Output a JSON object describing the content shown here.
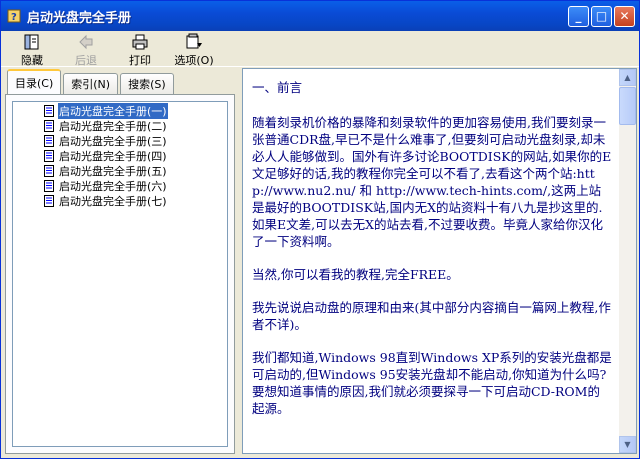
{
  "window": {
    "title": "启动光盘完全手册"
  },
  "toolbar": {
    "hide": "隐藏",
    "back": "后退",
    "print": "打印",
    "options": "选项(O)"
  },
  "tabs": [
    {
      "label": "目录(C)"
    },
    {
      "label": "索引(N)"
    },
    {
      "label": "搜索(S)"
    }
  ],
  "tree": {
    "items": [
      "启动光盘完全手册(一)",
      "启动光盘完全手册(二)",
      "启动光盘完全手册(三)",
      "启动光盘完全手册(四)",
      "启动光盘完全手册(五)",
      "启动光盘完全手册(六)",
      "启动光盘完全手册(七)"
    ],
    "selected_index": 0
  },
  "content": {
    "heading": "一、前言",
    "paragraphs": [
      "随着刻录机价格的暴降和刻录软件的更加容易使用,我们要刻录一张普通CDR盘,早已不是什么难事了,但要刻可启动光盘刻录,却未必人人能够做到。国外有许多讨论BOOTDISK的网站,如果你的E文足够好的话,我的教程你完全可以不看了,去看这个两个站:http://www.nu2.nu/ 和 http://www.tech-hints.com/,这两上站是最好的BOOTDISK站,国内无X的站资料十有八九是抄这里的.如果E文差,可以去无X的站去看,不过要收费。毕竟人家给你汉化了一下资料啊。",
      "当然,你可以看我的教程,完全FREE。",
      "我先说说启动盘的原理和由来(其中部分内容摘自一篇网上教程,作者不详)。",
      "我们都知道,Windows 98直到Windows XP系列的安装光盘都是可启动的,但Windows 95安装光盘却不能启动,你知道为什么吗?要想知道事情的原因,我们就必须要探寻一下可启动CD-ROM的起源。"
    ]
  },
  "colors": {
    "titlebar": "#0a4bd6",
    "content_text": "#00007f",
    "selection": "#316ac5"
  }
}
